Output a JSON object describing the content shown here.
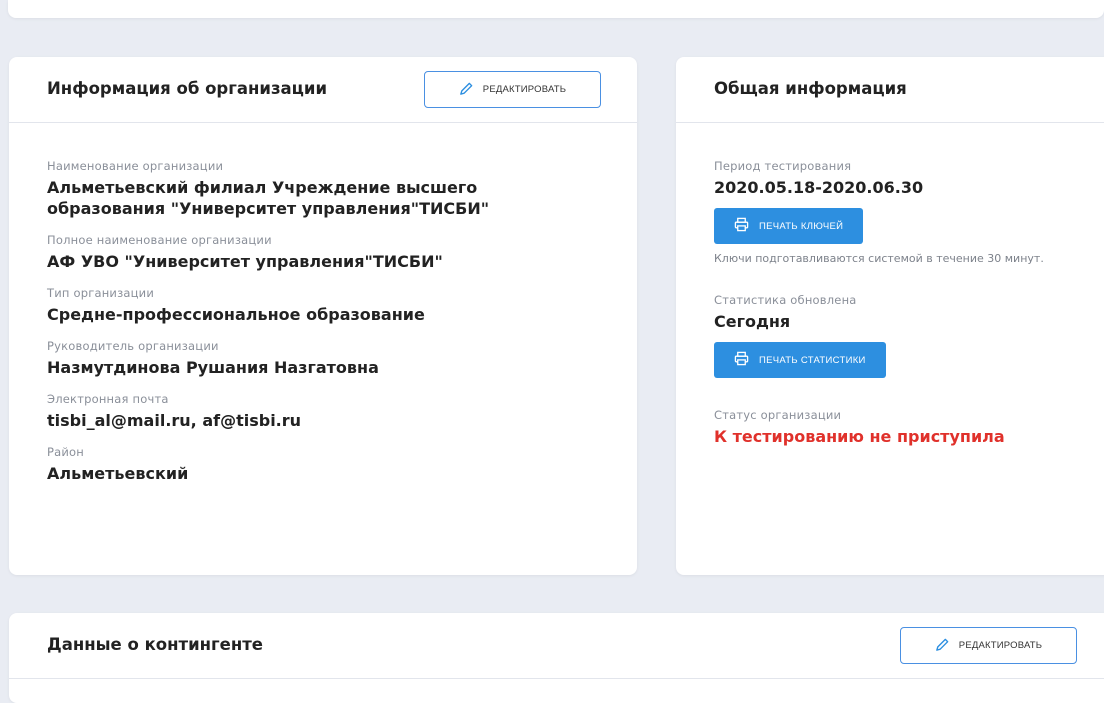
{
  "org_card": {
    "title": "Информация об организации",
    "edit_label": "РЕДАКТИРОВАТЬ",
    "fields": [
      {
        "label": "Наименование организации",
        "value": "Альметьевский филиал Учреждение высшего образования \"Университет управления\"ТИСБИ\""
      },
      {
        "label": "Полное наименование организации",
        "value": "АФ УВО \"Университет управления\"ТИСБИ\""
      },
      {
        "label": "Тип организации",
        "value": "Средне-профессиональное образование"
      },
      {
        "label": "Руководитель организации",
        "value": "Назмутдинова Рушания Назгатовна"
      },
      {
        "label": "Электронная почта",
        "value": "tisbi_al@mail.ru, af@tisbi.ru"
      },
      {
        "label": "Район",
        "value": "Альметьевский"
      }
    ]
  },
  "general_card": {
    "title": "Общая информация",
    "period_label": "Период тестирования",
    "period_value": "2020.05.18-2020.06.30",
    "print_keys_label": "ПЕЧАТЬ КЛЮЧЕЙ",
    "keys_note": "Ключи подготавливаются системой в течение 30 минут.",
    "stats_label": "Статистика обновлена",
    "stats_value": "Сегодня",
    "print_stats_label": "ПЕЧАТЬ СТАТИСТИКИ",
    "status_label": "Статус организации",
    "status_value": "К тестированию не приступила",
    "status_color": "#e0312b"
  },
  "contingent_card": {
    "title": "Данные о контингенте",
    "edit_label": "РЕДАКТИРОВАТЬ"
  },
  "colors": {
    "accent": "#2d8fe0",
    "outline": "#4a90e2",
    "background": "#e9ecf3"
  },
  "icons": {
    "edit": "pencil-icon",
    "print": "printer-icon"
  }
}
